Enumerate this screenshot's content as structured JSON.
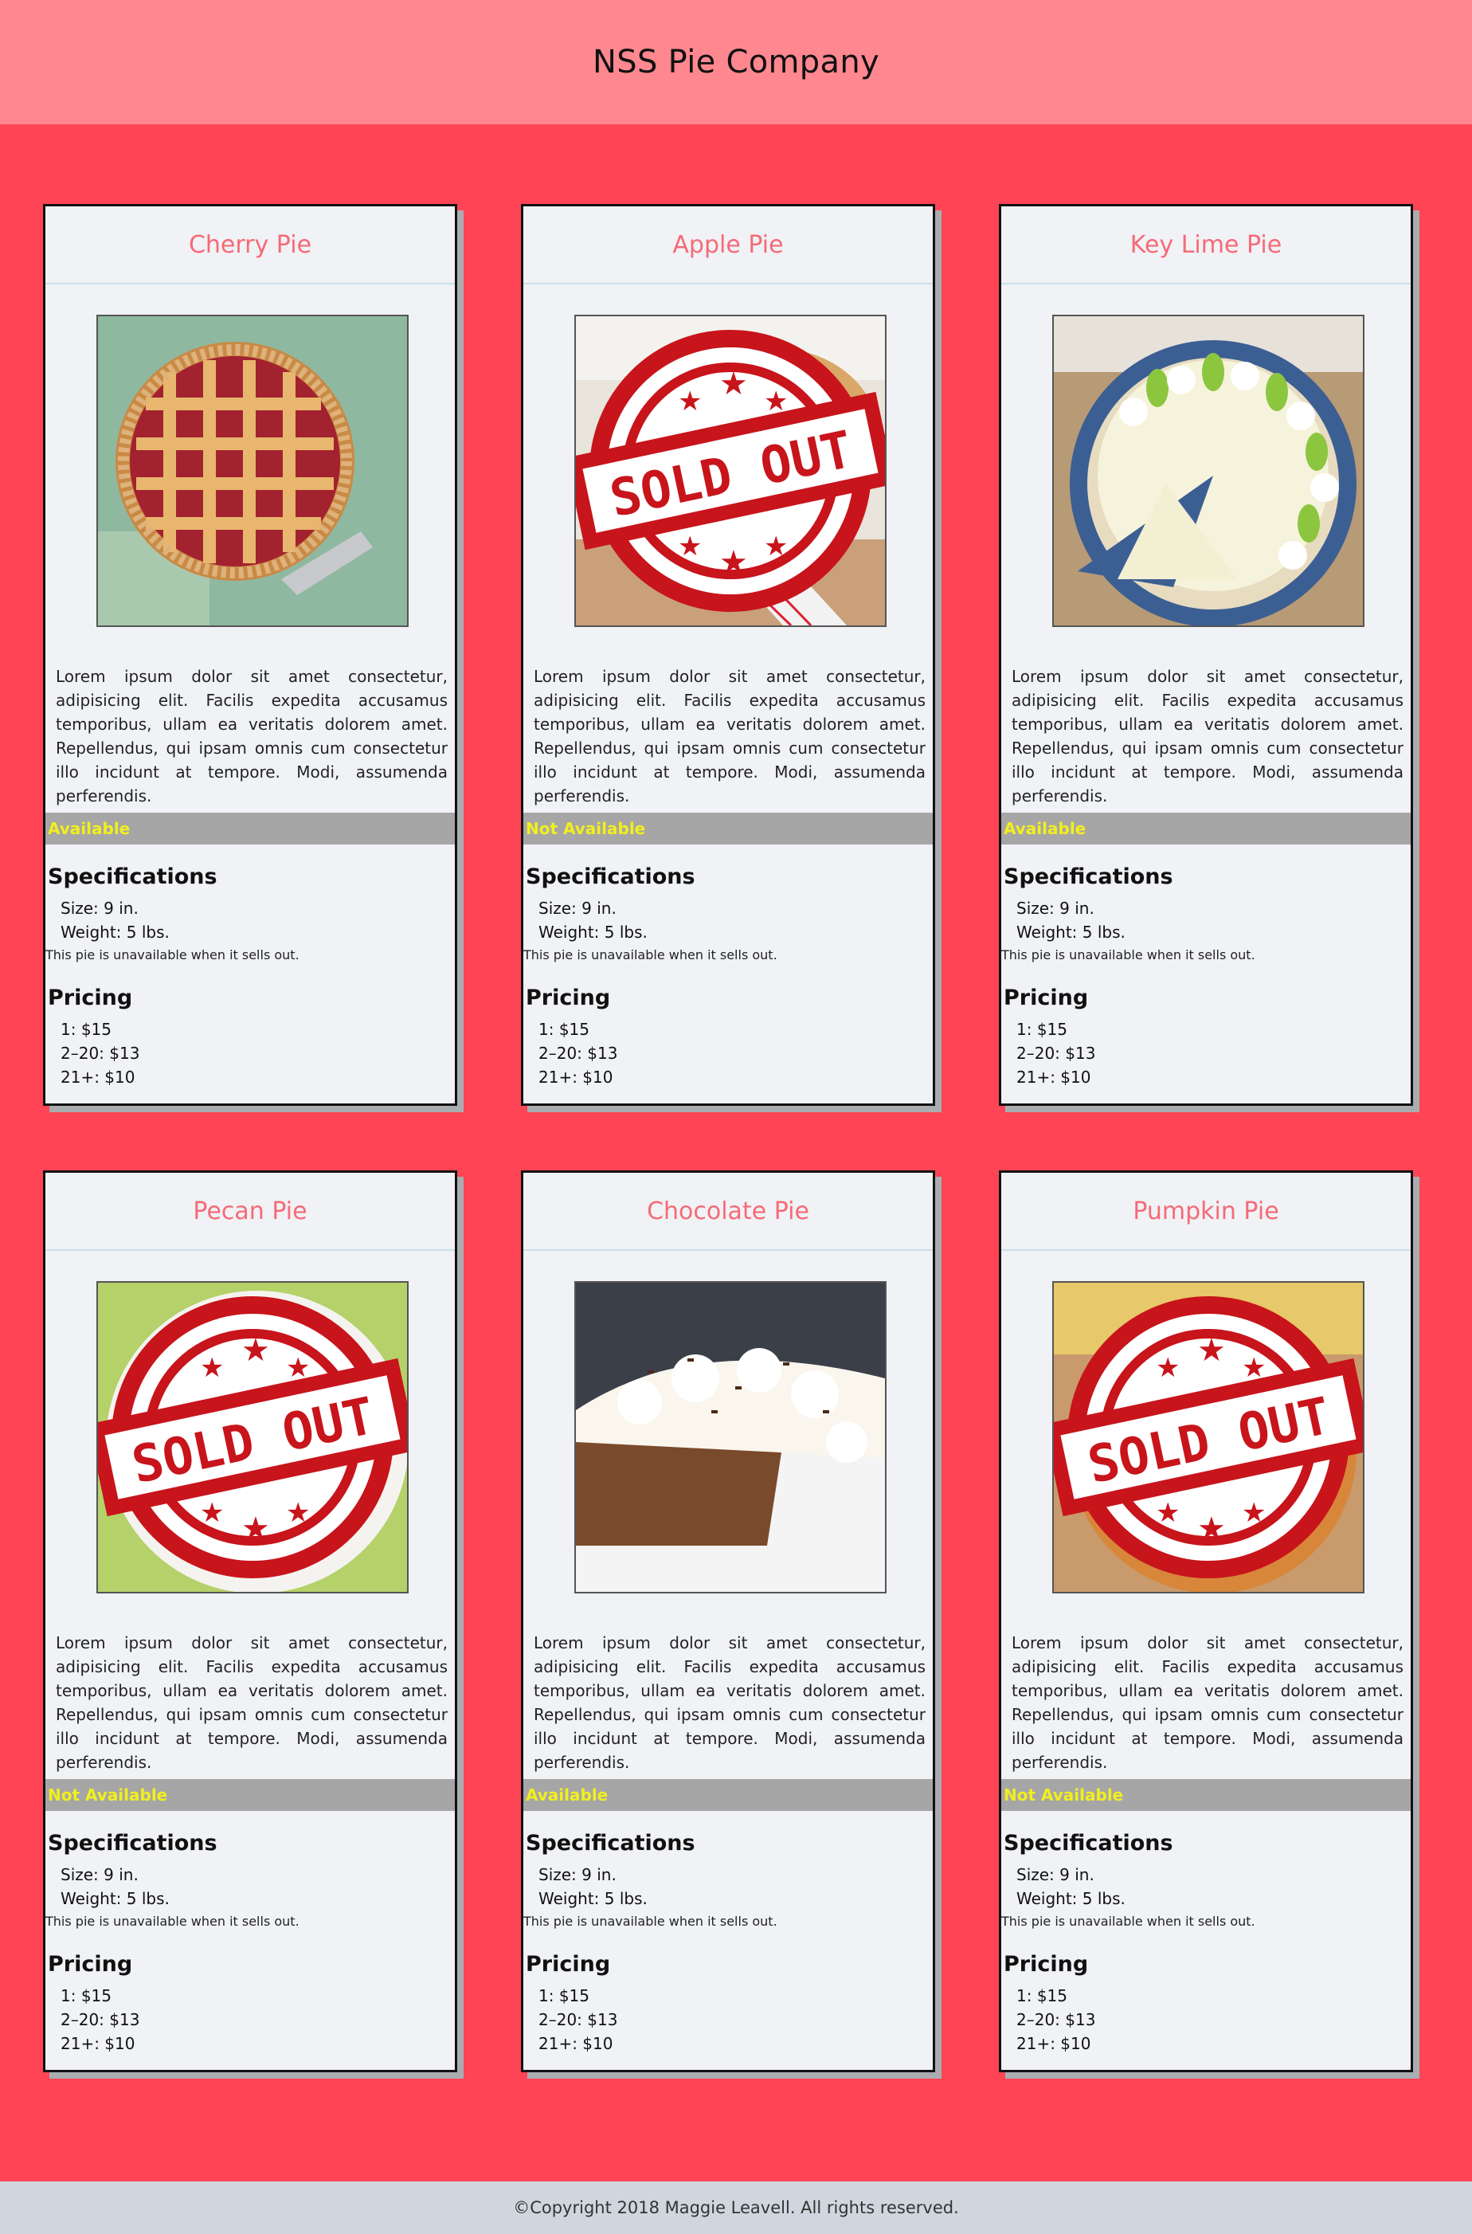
{
  "header": {
    "title": "NSS Pie Company"
  },
  "description": "Lorem ipsum dolor sit amet consectetur, adipisicing elit. Facilis expedita accusamus temporibus, ullam ea veritatis dolorem amet. Repellendus, qui ipsam omnis cum consectetur illo incidunt at tempore. Modi, assumenda perferendis.",
  "sold_out_stamp": "SOLD OUT",
  "pies": [
    {
      "name": "Cherry Pie",
      "availability": "Available",
      "sold_out": false,
      "specs_title": "Specifications",
      "size": "Size: 9 in.",
      "weight": "Weight: 5 lbs.",
      "note": "This pie is unavailable when it sells out.",
      "pricing_title": "Pricing",
      "price_1": "1: $15",
      "price_2": "2–20: $13",
      "price_3": "21+: $10"
    },
    {
      "name": "Apple Pie",
      "availability": "Not Available",
      "sold_out": true,
      "specs_title": "Specifications",
      "size": "Size: 9 in.",
      "weight": "Weight: 5 lbs.",
      "note": "This pie is unavailable when it sells out.",
      "pricing_title": "Pricing",
      "price_1": "1: $15",
      "price_2": "2–20: $13",
      "price_3": "21+: $10"
    },
    {
      "name": "Key Lime Pie",
      "availability": "Available",
      "sold_out": false,
      "specs_title": "Specifications",
      "size": "Size: 9 in.",
      "weight": "Weight: 5 lbs.",
      "note": "This pie is unavailable when it sells out.",
      "pricing_title": "Pricing",
      "price_1": "1: $15",
      "price_2": "2–20: $13",
      "price_3": "21+: $10"
    },
    {
      "name": "Pecan Pie",
      "availability": "Not Available",
      "sold_out": true,
      "specs_title": "Specifications",
      "size": "Size: 9 in.",
      "weight": "Weight: 5 lbs.",
      "note": "This pie is unavailable when it sells out.",
      "pricing_title": "Pricing",
      "price_1": "1: $15",
      "price_2": "2–20: $13",
      "price_3": "21+: $10"
    },
    {
      "name": "Chocolate Pie",
      "availability": "Available",
      "sold_out": false,
      "specs_title": "Specifications",
      "size": "Size: 9 in.",
      "weight": "Weight: 5 lbs.",
      "note": "This pie is unavailable when it sells out.",
      "pricing_title": "Pricing",
      "price_1": "1: $15",
      "price_2": "2–20: $13",
      "price_3": "21+: $10"
    },
    {
      "name": "Pumpkin Pie",
      "availability": "Not Available",
      "sold_out": true,
      "specs_title": "Specifications",
      "size": "Size: 9 in.",
      "weight": "Weight: 5 lbs.",
      "note": "This pie is unavailable when it sells out.",
      "pricing_title": "Pricing",
      "price_1": "1: $15",
      "price_2": "2–20: $13",
      "price_3": "21+: $10"
    }
  ],
  "footer": {
    "copyright": "©Copyright 2018 Maggie Leavell. All rights reserved."
  },
  "colors": {
    "page_bg": "#ff4555",
    "header_bg": "#ff8890",
    "card_bg": "#f0f2f5",
    "title_text": "#f66a77",
    "availability_bar": "#a6a6a6",
    "availability_text": "#f2ef1e",
    "footer_bg": "#cfd6de",
    "stamp_red": "#c8141b"
  }
}
